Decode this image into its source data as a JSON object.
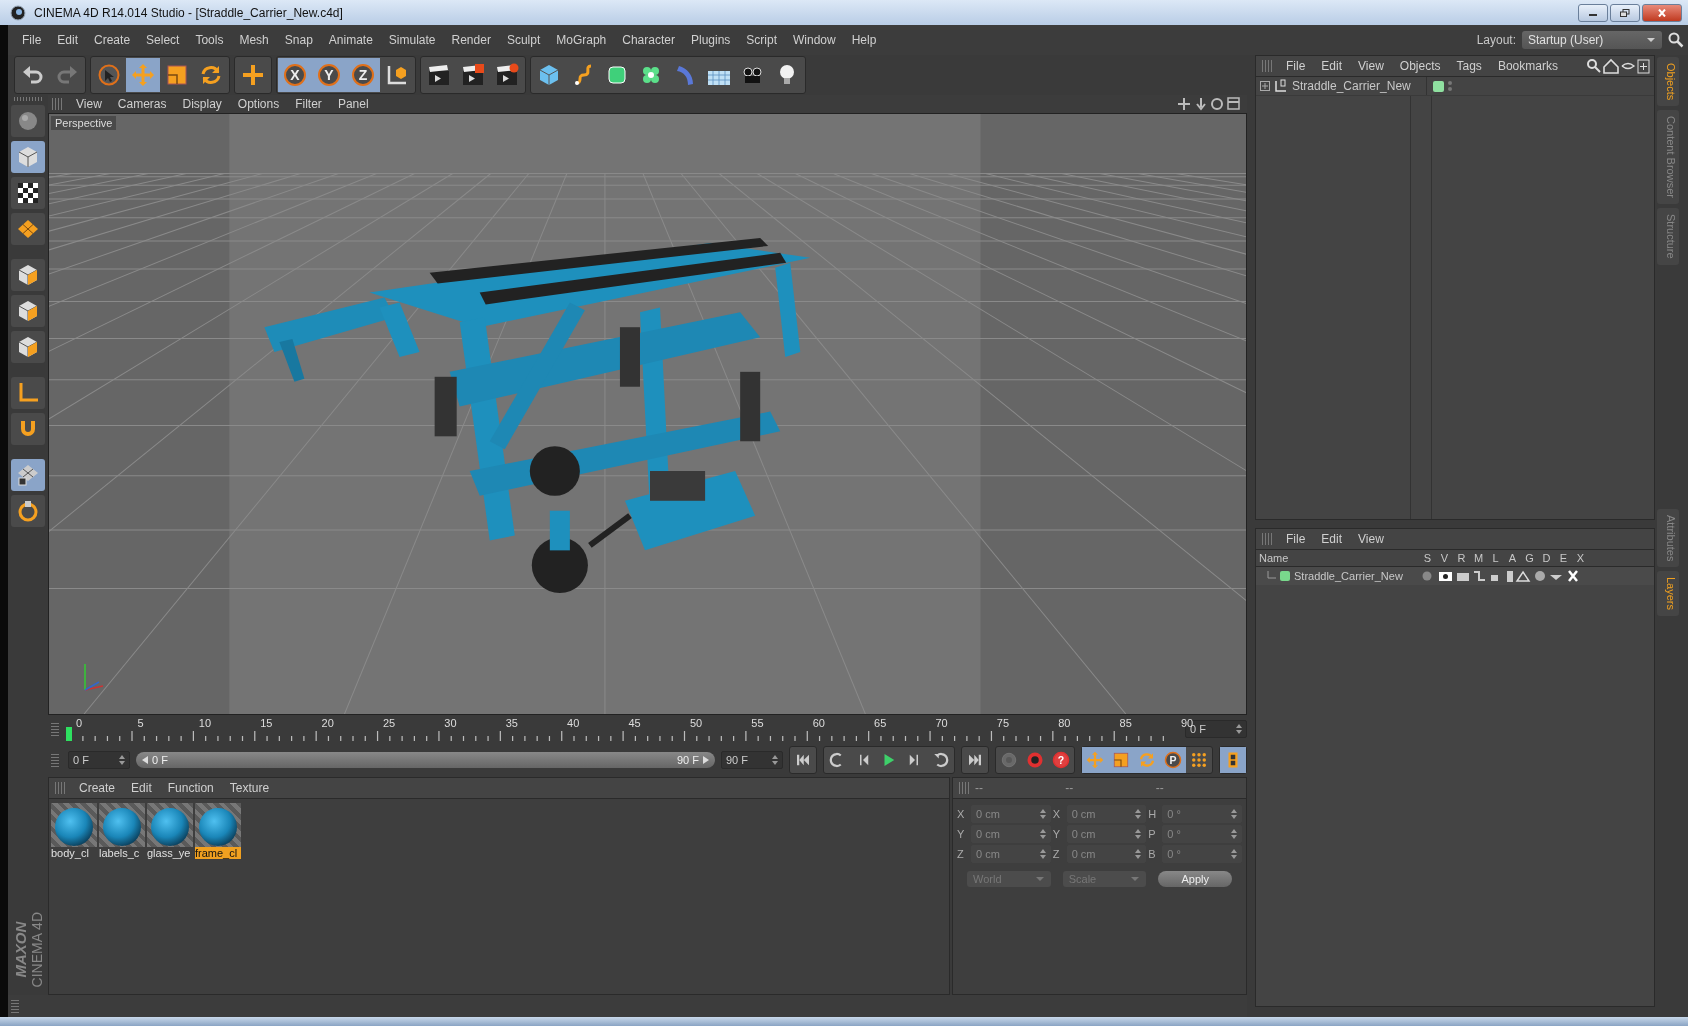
{
  "window": {
    "title": "CINEMA 4D R14.014 Studio - [Straddle_Carrier_New.c4d]"
  },
  "menu_bar": [
    "File",
    "Edit",
    "Create",
    "Select",
    "Tools",
    "Mesh",
    "Snap",
    "Animate",
    "Simulate",
    "Render",
    "Sculpt",
    "MoGraph",
    "Character",
    "Plugins",
    "Script",
    "Window",
    "Help"
  ],
  "layout": {
    "label": "Layout:",
    "value": "Startup (User)"
  },
  "toolbar": [
    [
      {
        "kind": "undo",
        "selected": false
      },
      {
        "kind": "redo",
        "selected": false
      }
    ],
    [
      {
        "kind": "select",
        "selected": false
      },
      {
        "kind": "move",
        "selected": true
      },
      {
        "kind": "scale",
        "selected": false
      },
      {
        "kind": "rotate",
        "selected": false
      }
    ],
    [
      {
        "kind": "add",
        "selected": false
      }
    ],
    [
      {
        "kind": "axis",
        "label": "X",
        "selected": true
      },
      {
        "kind": "axis",
        "label": "Y",
        "selected": true
      },
      {
        "kind": "axis",
        "label": "Z",
        "selected": true
      },
      {
        "kind": "coords",
        "selected": false
      }
    ],
    [
      {
        "kind": "render-view",
        "selected": false
      },
      {
        "kind": "render-picture",
        "selected": false
      },
      {
        "kind": "render-settings",
        "selected": false
      }
    ],
    [
      {
        "kind": "cube",
        "selected": false
      },
      {
        "kind": "spline",
        "selected": false
      },
      {
        "kind": "nurbs",
        "selected": false
      },
      {
        "kind": "cloner",
        "selected": false
      },
      {
        "kind": "deformer",
        "selected": false
      },
      {
        "kind": "floor",
        "selected": false
      },
      {
        "kind": "camera",
        "selected": false
      },
      {
        "kind": "light",
        "selected": false
      }
    ]
  ],
  "side_toolbar": [
    {
      "kind": "sphere",
      "selected": false
    },
    {
      "kind": "model",
      "selected": true
    },
    {
      "kind": "texture",
      "selected": false
    },
    {
      "kind": "workplane",
      "selected": false
    },
    {
      "kind": "points",
      "selected": false
    },
    {
      "kind": "edges",
      "selected": false
    },
    {
      "kind": "polygons",
      "selected": false
    },
    {
      "kind": "axis-tool",
      "selected": false
    },
    {
      "kind": "magnet",
      "selected": false
    },
    {
      "kind": "grid-lock",
      "selected": true
    },
    {
      "kind": "snap",
      "selected": false
    }
  ],
  "logo": {
    "brand": "MAXON",
    "product": "CINEMA 4D"
  },
  "viewport": {
    "menu": [
      "View",
      "Cameras",
      "Display",
      "Options",
      "Filter",
      "Panel"
    ],
    "label": "Perspective"
  },
  "timeline": {
    "ticks": [
      "0",
      "5",
      "10",
      "15",
      "20",
      "25",
      "30",
      "35",
      "40",
      "45",
      "50",
      "55",
      "60",
      "65",
      "70",
      "75",
      "80",
      "85",
      "90"
    ],
    "playhead": {
      "level": 0
    },
    "current_frame": "0 F",
    "start_field": "0 F",
    "range": {
      "start": "0 F",
      "end": "90 F",
      "level": 1
    },
    "end_field": "90 F"
  },
  "transport": [
    [
      {
        "kind": "first"
      }
    ],
    [
      {
        "kind": "prev-key"
      },
      {
        "kind": "step-back"
      },
      {
        "kind": "play"
      },
      {
        "kind": "step-forward"
      },
      {
        "kind": "next-key"
      }
    ],
    [
      {
        "kind": "last"
      }
    ],
    [
      {
        "kind": "record",
        "disabled": true
      },
      {
        "kind": "autokey",
        "disabled": false
      },
      {
        "kind": "help",
        "label": "?",
        "disabled": false
      }
    ],
    [
      {
        "kind": "move",
        "selected": true
      },
      {
        "kind": "scale",
        "selected": true
      },
      {
        "kind": "rotate",
        "selected": true
      },
      {
        "kind": "param",
        "label": "P",
        "selected": true
      },
      {
        "kind": "dots",
        "selected": false
      }
    ],
    [
      {
        "kind": "film",
        "selected": true
      }
    ]
  ],
  "materials": {
    "menu": [
      "Create",
      "Edit",
      "Function",
      "Texture"
    ],
    "items": [
      {
        "name": "body_cl",
        "selected": false
      },
      {
        "name": "labels_c",
        "selected": false
      },
      {
        "name": "glass_ye",
        "selected": false
      },
      {
        "name": "frame_cl",
        "selected": true
      }
    ]
  },
  "coordinates": {
    "headers": [
      "--",
      "--",
      "--"
    ],
    "rows": [
      [
        {
          "axis": "X",
          "value": "0 cm"
        },
        {
          "axis": "X",
          "value": "0 cm"
        },
        {
          "axis": "H",
          "value": "0 °"
        }
      ],
      [
        {
          "axis": "Y",
          "value": "0 cm"
        },
        {
          "axis": "Y",
          "value": "0 cm"
        },
        {
          "axis": "P",
          "value": "0 °"
        }
      ],
      [
        {
          "axis": "Z",
          "value": "0 cm"
        },
        {
          "axis": "Z",
          "value": "0 cm"
        },
        {
          "axis": "B",
          "value": "0 °"
        }
      ]
    ],
    "space": "World",
    "mode": "Scale",
    "apply": "Apply"
  },
  "objects": {
    "menu": [
      "File",
      "Edit",
      "View",
      "Objects",
      "Tags",
      "Bookmarks"
    ],
    "items": [
      {
        "name": "Straddle_Carrier_New",
        "color": "#8fe0a0"
      }
    ]
  },
  "layers": {
    "menu": [
      "File",
      "Edit",
      "View"
    ],
    "columns": [
      "Name",
      "S",
      "V",
      "R",
      "M",
      "L",
      "A",
      "G",
      "D",
      "E",
      "X"
    ],
    "items": [
      {
        "name": "Straddle_Carrier_New",
        "color": "#79d98c"
      }
    ]
  },
  "side_tabs": [
    {
      "label": "Objects",
      "selected": true
    },
    {
      "label": "Content Browser",
      "selected": false
    },
    {
      "label": "Structure",
      "selected": false
    },
    {
      "label": "Attributes",
      "selected": false
    },
    {
      "label": "Layers",
      "selected": true
    }
  ]
}
